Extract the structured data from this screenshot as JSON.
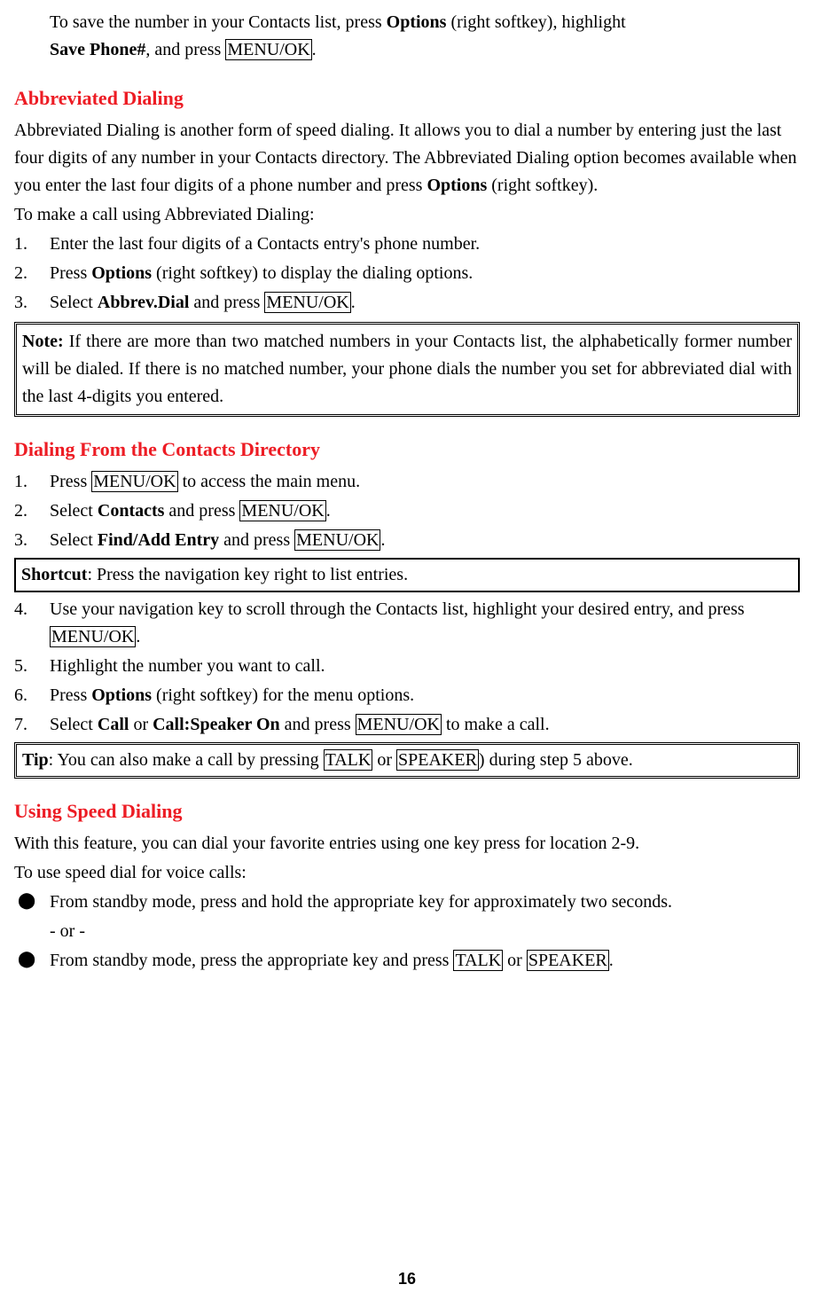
{
  "intro": {
    "p1_a": "To save the number in your Contacts list, press ",
    "p1_options": "Options",
    "p1_b": " (right softkey), highlight ",
    "p2_a": "Save Phone#",
    "p2_b": ", and press ",
    "p2_menu": "MENU/OK",
    "p2_c": "."
  },
  "abbrev": {
    "heading": "Abbreviated Dialing",
    "desc_a": "Abbreviated Dialing is another form of speed dialing. It allows you to dial a number by entering just the last four digits of any number in your Contacts directory. The Abbreviated Dialing option becomes available when you enter the last four digits of a phone number and press ",
    "desc_options": "Options",
    "desc_b": " (right softkey).",
    "lead": "To make a call using Abbreviated Dialing:",
    "steps": [
      {
        "n": "1.",
        "t": "Enter the last four digits of a Contacts entry's phone number."
      },
      {
        "n": "2.",
        "a": "Press ",
        "b": "Options",
        "c": " (right softkey) to display the dialing options."
      },
      {
        "n": "3.",
        "a": "Select ",
        "b": "Abbrev.Dial",
        "c": " and press ",
        "d": "MENU/OK",
        "e": "."
      }
    ],
    "note_label": "Note:",
    "note_text": " If there are more than two matched numbers in your Contacts list, the alphabetically former number will be dialed. If there is no matched number, your phone dials the number you set for abbreviated dial with the last 4-digits you entered."
  },
  "contacts": {
    "heading": "Dialing From the Contacts Directory",
    "s1": {
      "n": "1.",
      "a": "Press ",
      "b": "MENU/OK",
      "c": " to access the main menu."
    },
    "s2": {
      "n": "2.",
      "a": "Select ",
      "b": "Contacts",
      "c": " and press ",
      "d": "MENU/OK",
      "e": "."
    },
    "s3": {
      "n": "3.",
      "a": "Select ",
      "b": "Find/Add Entry",
      "c": " and press ",
      "d": "MENU/OK",
      "e": "."
    },
    "shortcut_label": "Shortcut",
    "shortcut_text": ": Press the navigation key right to list entries.",
    "s4": {
      "n": "4.",
      "a": "Use your navigation key to scroll through the Contacts list, highlight your desired entry, and press ",
      "b": "MENU/OK",
      "c": "."
    },
    "s5": {
      "n": "5.",
      "t": "Highlight the number you want to call."
    },
    "s6": {
      "n": "6.",
      "a": "Press ",
      "b": "Options",
      "c": " (right softkey) for the menu options."
    },
    "s7": {
      "n": "7.",
      "a": "Select ",
      "b": "Call",
      "c": " or ",
      "d": "Call:Speaker On",
      "e": " and press ",
      "f": "MENU/OK",
      "g": " to make a call."
    },
    "tip_label": "Tip",
    "tip_a": ": You can also make a call by pressing ",
    "tip_talk": "TALK",
    "tip_b": " or ",
    "tip_spk": "SPEAKER",
    "tip_c": ") during step 5 above."
  },
  "speed": {
    "heading": "Using Speed Dialing",
    "desc": "With this feature, you can dial your favorite entries using one key press for location 2-9.",
    "lead": "To use speed dial for voice calls:",
    "b1": "From standby mode, press and hold the appropriate key for approximately two seconds.",
    "or": "- or -",
    "b2_a": "From standby mode, press the appropriate key and press ",
    "b2_talk": "TALK",
    "b2_b": " or ",
    "b2_spk": "SPEAKER",
    "b2_c": "."
  },
  "page": "16"
}
